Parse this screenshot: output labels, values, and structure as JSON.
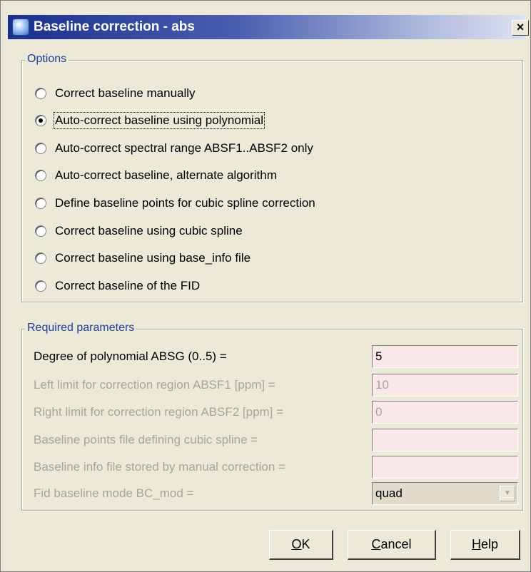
{
  "window": {
    "title": "Baseline correction - abs",
    "close_label": "×"
  },
  "options": {
    "legend": "Options",
    "selected_index": 1,
    "items": [
      "Correct baseline manually",
      "Auto-correct baseline using polynomial",
      "Auto-correct spectral range ABSF1..ABSF2 only",
      "Auto-correct baseline, alternate algorithm",
      "Define baseline points for cubic spline correction",
      "Correct baseline using cubic spline",
      "Correct baseline using base_info file",
      "Correct baseline of the FID"
    ]
  },
  "params": {
    "legend": "Required parameters",
    "rows": [
      {
        "label": "Degree of polynomial ABSG (0..5) =",
        "value": "5",
        "enabled": true
      },
      {
        "label": "Left limit for correction region ABSF1 [ppm] =",
        "value": "10",
        "enabled": false
      },
      {
        "label": "Right limit for correction region ABSF2 [ppm] =",
        "value": "0",
        "enabled": false
      },
      {
        "label": "Baseline points file defining cubic spline =",
        "value": "",
        "enabled": false
      },
      {
        "label": "Baseline info file stored by manual correction =",
        "value": "",
        "enabled": false
      }
    ],
    "select": {
      "label": "Fid baseline mode BC_mod =",
      "value": "quad",
      "enabled": false
    }
  },
  "buttons": {
    "ok": {
      "mnemonic": "O",
      "rest": "K"
    },
    "cancel": {
      "mnemonic": "C",
      "rest": "ancel"
    },
    "help": {
      "mnemonic": "H",
      "rest": "elp"
    }
  }
}
